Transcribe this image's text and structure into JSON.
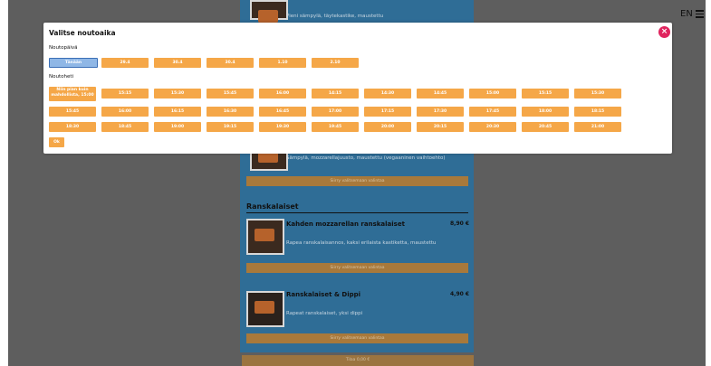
{
  "header": {
    "language": "EN",
    "menu_icon": "hamburger-icon"
  },
  "background_menu": {
    "top_item_desc": "Pieni sämpylä, täytekastike, maustettu",
    "mid_item_desc": "Sämpylä, mozzarellajuusto, maustettu (vegaaninen vaihtoehto)",
    "choose_label": "Siirry valitsemaan valintaa",
    "section_title": "Ranskalaiset",
    "items": [
      {
        "name": "Kahden mozzarellan ranskalaiset",
        "price": "8,90 €",
        "desc": "Rapea ranskalaisannos, kaksi erilaista kastiketta, maustettu",
        "choose": "Siirry valitsemaan valintaa"
      },
      {
        "name": "Ranskalaiset & Dippi",
        "price": "4,90 €",
        "desc": "Rapeat ranskalaiset, yksi dippi",
        "choose": "Siirry valitsemaan valintaa"
      }
    ],
    "bottom_bar": "Tilaa 0,00 €"
  },
  "modal": {
    "title": "Valitse noutoaika",
    "close_icon": "close-icon",
    "day_label": "Noutopäivä",
    "days": [
      "Tänään",
      "29.4",
      "30.4",
      "30.4",
      "1.10",
      "2.10"
    ],
    "time_label": "Noutoheti",
    "asap_line1": "Niin pian kuin",
    "asap_line2": "mahdollista, 15:00",
    "times_row1": [
      "15:15",
      "15:30",
      "15:45",
      "16:00",
      "14:15",
      "14:30",
      "14:45",
      "15:00",
      "15:15",
      "15:30"
    ],
    "times_row2": [
      "15:45",
      "16:00",
      "16:15",
      "16:30",
      "16:45",
      "17:00",
      "17:15",
      "17:30",
      "17:45",
      "18:00",
      "18:15"
    ],
    "times_row3": [
      "18:30",
      "18:45",
      "19:00",
      "19:15",
      "19:30",
      "19:45",
      "20:00",
      "20:15",
      "20:30",
      "20:45",
      "21:00"
    ],
    "ok_label": "Ok"
  }
}
